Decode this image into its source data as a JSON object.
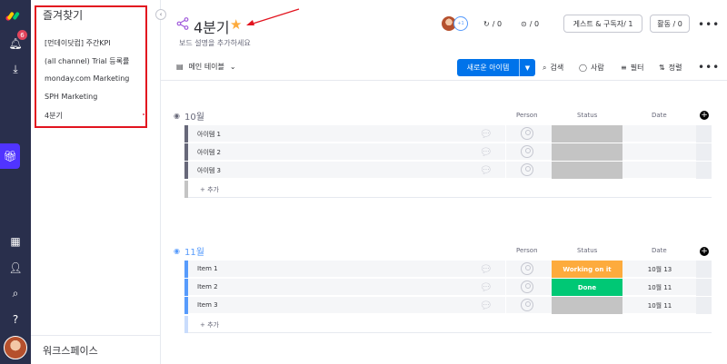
{
  "rail": {
    "notification_count": "6"
  },
  "favorites": {
    "title": "즐겨찾기",
    "items": [
      {
        "label": "[먼데이닷컴] 주간KPI"
      },
      {
        "label": "(all channel) Trial 등록률"
      },
      {
        "label": "monday.com Marketing"
      },
      {
        "label": "SPH Marketing"
      },
      {
        "label": "4분기"
      }
    ],
    "footer": "워크스페이스"
  },
  "board": {
    "title": "4분기",
    "description": "보드 설명을 추가하세요",
    "avatar2_label": "+1"
  },
  "header": {
    "activity_count": "/ 0",
    "updates_count": "/ 0",
    "guests_label": "게스트 & 구독자/ 1",
    "activity_label": "활동 / 0",
    "more": "•••"
  },
  "toolbar": {
    "view_label": "메인 테이블",
    "new_item": "새로운 아이템",
    "search": "검색",
    "person": "사람",
    "filter": "필터",
    "sort": "정렬",
    "more": "•••"
  },
  "columns": {
    "person": "Person",
    "status": "Status",
    "date": "Date"
  },
  "groups": [
    {
      "name": "10월",
      "color": "#676879",
      "bar_color": "#676879",
      "add_label": "+ 추가",
      "rows": [
        {
          "name": "아이템 1",
          "status": "",
          "status_color": "#c4c4c4",
          "date": ""
        },
        {
          "name": "아이템 2",
          "status": "",
          "status_color": "#c4c4c4",
          "date": ""
        },
        {
          "name": "아이템 3",
          "status": "",
          "status_color": "#c4c4c4",
          "date": ""
        }
      ]
    },
    {
      "name": "11월",
      "color": "#579bfc",
      "bar_color": "#579bfc",
      "add_label": "+ 추가",
      "rows": [
        {
          "name": "Item 1",
          "status": "Working on it",
          "status_color": "#fdab3d",
          "date": "10월 13"
        },
        {
          "name": "Item 2",
          "status": "Done",
          "status_color": "#00c875",
          "date": "10월 11"
        },
        {
          "name": "Item 3",
          "status": "",
          "status_color": "#c4c4c4",
          "date": "10월 11"
        }
      ]
    }
  ]
}
